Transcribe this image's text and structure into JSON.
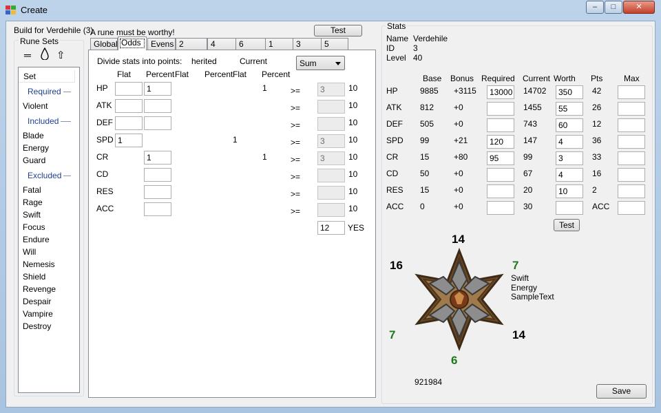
{
  "window": {
    "title": "Create"
  },
  "left": {
    "build_label": "Build for Verdehile (3)",
    "rune_sets_title": "Rune Sets",
    "list_header": "Set",
    "required_header": "Required",
    "required": [
      "Violent"
    ],
    "included_header": "Included",
    "included": [
      "Blade",
      "Energy",
      "Guard"
    ],
    "excluded_header": "Excluded",
    "excluded": [
      "Fatal",
      "Rage",
      "Swift",
      "Focus",
      "Endure",
      "Will",
      "Nemesis",
      "Shield",
      "Revenge",
      "Despair",
      "Vampire",
      "Destroy"
    ]
  },
  "middle": {
    "message": "A rune must be worthy!",
    "test_button": "Test",
    "tabs": [
      "Global",
      "Odds",
      "Evens",
      "2",
      "4",
      "6",
      "1",
      "3",
      "5"
    ],
    "active_tab": "Odds",
    "divide_label": "Divide stats into points:",
    "inherited_label": "herited",
    "current_label": "Current",
    "combo_value": "Sum",
    "col_headers": [
      "Flat",
      "Percent",
      "Flat",
      "Percent",
      "Flat",
      "Percent"
    ],
    "rows": [
      {
        "stat": "HP",
        "flat": "",
        "percent": "1",
        "has_flat": true,
        "has_percent": true,
        "current_flat": "",
        "current_percent": "1",
        "op": ">=",
        "min": "3",
        "max": "10"
      },
      {
        "stat": "ATK",
        "flat": "",
        "percent": "",
        "has_flat": true,
        "has_percent": true,
        "current_flat": "",
        "current_percent": "",
        "op": ">=",
        "min": "",
        "max": "10"
      },
      {
        "stat": "DEF",
        "flat": "",
        "percent": "",
        "has_flat": true,
        "has_percent": true,
        "current_flat": "",
        "current_percent": "",
        "op": ">=",
        "min": "",
        "max": "10"
      },
      {
        "stat": "SPD",
        "flat": "1",
        "percent": "",
        "has_flat": true,
        "has_percent": false,
        "current_flat": "1",
        "current_percent": "",
        "op": ">=",
        "min": "3",
        "max": "10"
      },
      {
        "stat": "CR",
        "flat": "",
        "percent": "1",
        "has_flat": false,
        "has_percent": true,
        "current_flat": "",
        "current_percent": "1",
        "op": ">=",
        "min": "3",
        "max": "10"
      },
      {
        "stat": "CD",
        "flat": "",
        "percent": "",
        "has_flat": false,
        "has_percent": true,
        "current_flat": "",
        "current_percent": "",
        "op": ">=",
        "min": "",
        "max": "10"
      },
      {
        "stat": "RES",
        "flat": "",
        "percent": "",
        "has_flat": false,
        "has_percent": true,
        "current_flat": "",
        "current_percent": "",
        "op": ">=",
        "min": "",
        "max": "10"
      },
      {
        "stat": "ACC",
        "flat": "",
        "percent": "",
        "has_flat": false,
        "has_percent": true,
        "current_flat": "",
        "current_percent": "",
        "op": ">=",
        "min": "",
        "max": "10"
      }
    ],
    "total_value": "12",
    "total_result": "YES"
  },
  "stats": {
    "title": "Stats",
    "name_label": "Name",
    "name": "Verdehile",
    "id_label": "ID",
    "id": "3",
    "level_label": "Level",
    "level": "40",
    "headers": [
      "Base",
      "Bonus",
      "Required",
      "Current",
      "Worth",
      "Pts",
      "Max"
    ],
    "rows": [
      {
        "stat": "HP",
        "base": "9885",
        "bonus": "+3115",
        "required": "13000",
        "current": "14702",
        "worth": "350",
        "pts": "42",
        "max": ""
      },
      {
        "stat": "ATK",
        "base": "812",
        "bonus": "+0",
        "required": "",
        "current": "1455",
        "worth": "55",
        "pts": "26",
        "max": ""
      },
      {
        "stat": "DEF",
        "base": "505",
        "bonus": "+0",
        "required": "",
        "current": "743",
        "worth": "60",
        "pts": "12",
        "max": ""
      },
      {
        "stat": "SPD",
        "base": "99",
        "bonus": "+21",
        "required": "120",
        "current": "147",
        "worth": "4",
        "pts": "36",
        "max": ""
      },
      {
        "stat": "CR",
        "base": "15",
        "bonus": "+80",
        "required": "95",
        "current": "99",
        "worth": "3",
        "pts": "33",
        "max": ""
      },
      {
        "stat": "CD",
        "base": "50",
        "bonus": "+0",
        "required": "",
        "current": "67",
        "worth": "4",
        "pts": "16",
        "max": ""
      },
      {
        "stat": "RES",
        "base": "15",
        "bonus": "+0",
        "required": "",
        "current": "20",
        "worth": "10",
        "pts": "2",
        "max": ""
      },
      {
        "stat": "ACC",
        "base": "0",
        "bonus": "+0",
        "required": "",
        "current": "30",
        "worth": "",
        "pts": "ACC",
        "max": ""
      }
    ],
    "test_button": "Test",
    "rune_slots": {
      "top": "14",
      "top_right": "7",
      "bottom_right": "14",
      "bottom": "6",
      "bottom_left": "7",
      "top_left": "16"
    },
    "rune_info": [
      "Swift",
      "Energy",
      "SampleText"
    ],
    "score": "921984",
    "save_button": "Save",
    "colors": {
      "highlight_green": "#1c7a1c"
    }
  }
}
